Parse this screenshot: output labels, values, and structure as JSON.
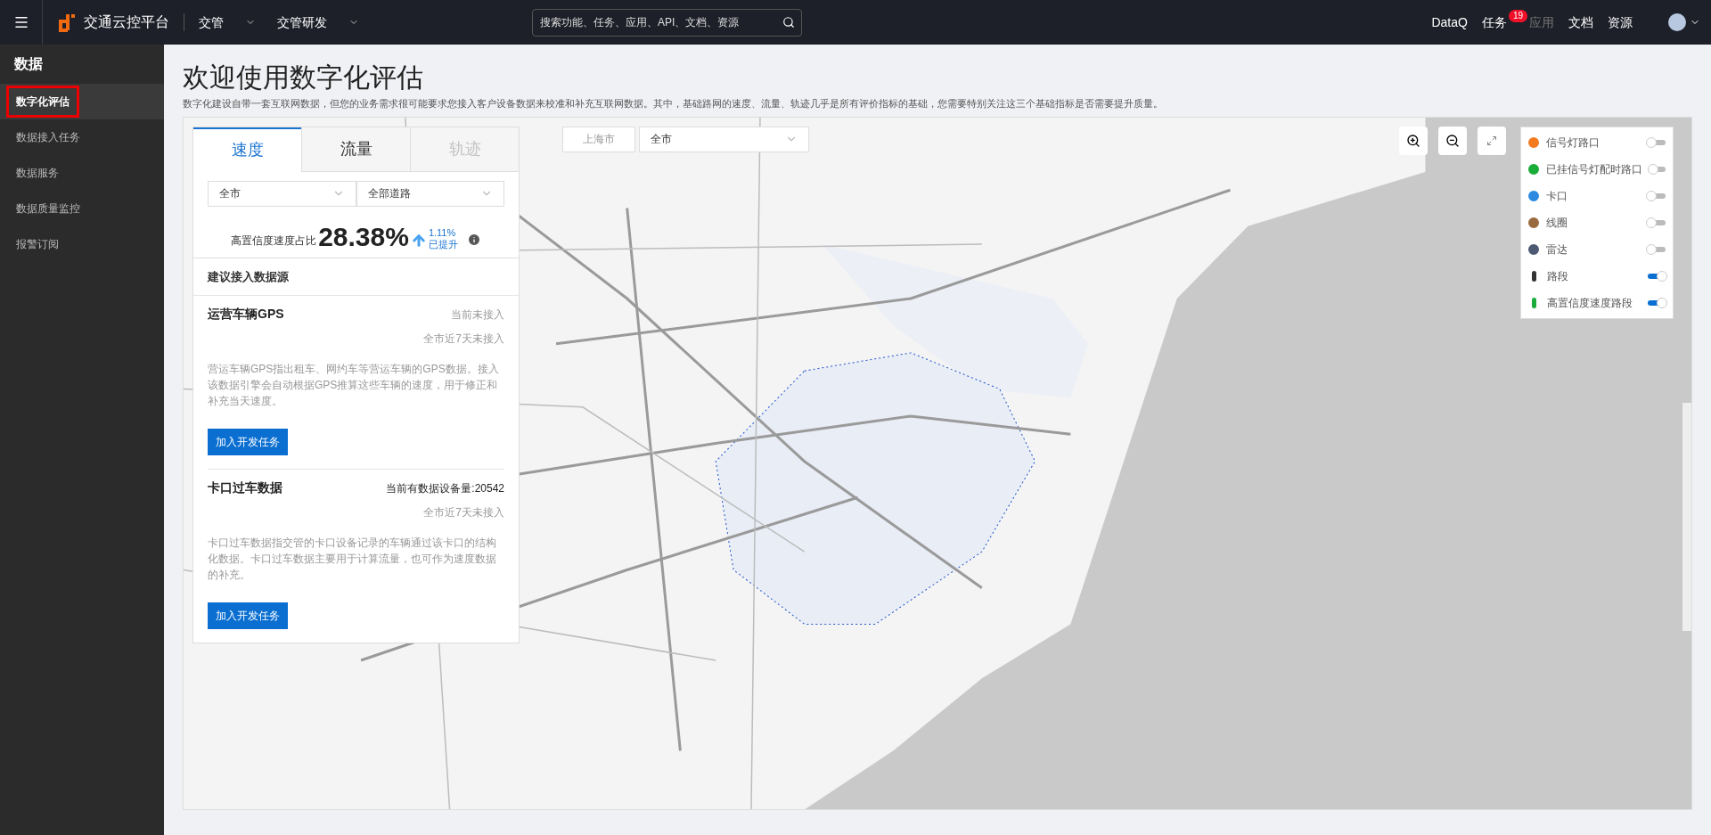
{
  "header": {
    "brand": "交通云控平台",
    "menus": [
      {
        "label": "交管"
      },
      {
        "label": "交管研发"
      }
    ],
    "search": {
      "placeholder": "搜索功能、任务、应用、API、文档、资源"
    },
    "links": [
      {
        "label": "DataQ",
        "disabled": false
      },
      {
        "label": "任务",
        "disabled": false,
        "badge": "19"
      },
      {
        "label": "应用",
        "disabled": true
      },
      {
        "label": "文档",
        "disabled": false
      },
      {
        "label": "资源",
        "disabled": false
      }
    ]
  },
  "sidebar": {
    "title": "数据",
    "items": [
      {
        "label": "数字化评估",
        "selected": true
      },
      {
        "label": "数据接入任务",
        "selected": false
      },
      {
        "label": "数据服务",
        "selected": false
      },
      {
        "label": "数据质量监控",
        "selected": false
      },
      {
        "label": "报警订阅",
        "selected": false
      }
    ]
  },
  "page": {
    "title": "欢迎使用数字化评估",
    "description": "数字化建设自带一套互联网数据，但您的业务需求很可能要求您接入客户设备数据来校准和补充互联网数据。其中，基础路网的速度、流量、轨迹几乎是所有评价指标的基础，您需要特别关注这三个基础指标是否需要提升质量。"
  },
  "panel": {
    "tabs": [
      {
        "label": "速度",
        "selected": true,
        "disabled": false
      },
      {
        "label": "流量",
        "selected": false,
        "disabled": false
      },
      {
        "label": "轨迹",
        "selected": false,
        "disabled": true
      }
    ],
    "filters": [
      {
        "value": "全市"
      },
      {
        "value": "全部道路"
      }
    ],
    "metric": {
      "label": "高置信度速度占比",
      "value": "28.38%",
      "change": "1.11%",
      "change_label": "已提升"
    },
    "section_title": "建议接入数据源",
    "sources": [
      {
        "name": "运营车辆GPS",
        "status": "当前未接入",
        "status_highlight": false,
        "recent": "全市近7天未接入",
        "description": "营运车辆GPS指出租车、网约车等营运车辆的GPS数据。接入该数据引擎会自动根据GPS推算这些车辆的速度，用于修正和补充当天速度。",
        "button": "加入开发任务"
      },
      {
        "name": "卡口过车数据",
        "status": "当前有数据设备量:20542",
        "status_highlight": true,
        "recent": "全市近7天未接入",
        "description": "卡口过车数据指交管的卡口设备记录的车辆通过该卡口的结构化数据。卡口过车数据主要用于计算流量，也可作为速度数据的补充。",
        "button": "加入开发任务"
      }
    ]
  },
  "map": {
    "region": {
      "city": "上海市",
      "district": "全市"
    },
    "layers": [
      {
        "label": "信号灯路口",
        "kind": "dot",
        "color": "#f47b20",
        "on": false
      },
      {
        "label": "已挂信号灯配时路口",
        "kind": "dot",
        "color": "#1aad3a",
        "on": false
      },
      {
        "label": "卡口",
        "kind": "dot",
        "color": "#2d8ae0",
        "on": false
      },
      {
        "label": "线圈",
        "kind": "dot",
        "color": "#9a6a3e",
        "on": false
      },
      {
        "label": "雷达",
        "kind": "dot",
        "color": "#4c5a73",
        "on": false
      },
      {
        "label": "路段",
        "kind": "bar",
        "color": "#333333",
        "on": true
      },
      {
        "label": "高置信度速度路段",
        "kind": "bar",
        "color": "#1aad3a",
        "on": true
      }
    ]
  }
}
